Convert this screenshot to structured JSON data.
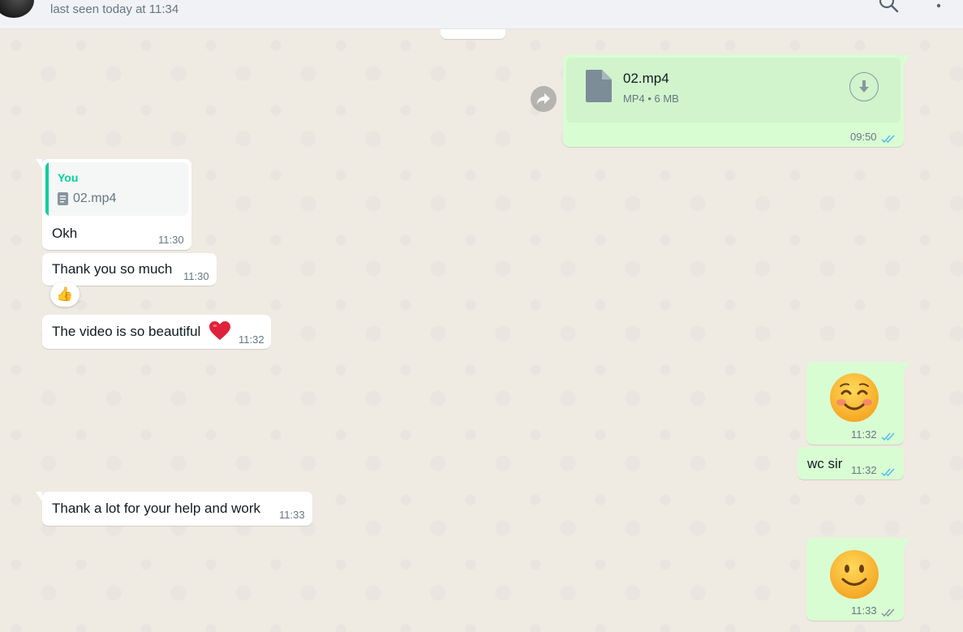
{
  "header": {
    "last_seen": "last seen today at 11:34",
    "search_icon": "search-icon",
    "menu_icon": "menu-dots-icon"
  },
  "colors": {
    "incoming_bubble": "#ffffff",
    "outgoing_bubble": "#d9fdd3",
    "chat_background": "#efeae2",
    "accent_green": "#06cf9c",
    "read_tick_blue": "#53bdeb",
    "delivered_tick_grey": "#8696a0"
  },
  "messages": [
    {
      "id": "m1",
      "direction": "out",
      "type": "file",
      "file_name": "02.mp4",
      "file_meta": "MP4 • 6 MB",
      "time": "09:50",
      "status": "read"
    },
    {
      "id": "m2",
      "direction": "in",
      "type": "reply",
      "quote_author": "You",
      "quote_file": "02.mp4",
      "text": "Okh",
      "time": "11:30"
    },
    {
      "id": "m3",
      "direction": "in",
      "type": "text",
      "text": "Thank you so much",
      "time": "11:30",
      "reaction": "👍"
    },
    {
      "id": "m4",
      "direction": "in",
      "type": "text",
      "text": "The video is so beautiful",
      "emoji": "heart",
      "time": "11:32"
    },
    {
      "id": "m5",
      "direction": "out",
      "type": "emoji",
      "emoji": "smiling-face-with-smiling-eyes",
      "time": "11:32",
      "status": "read"
    },
    {
      "id": "m6",
      "direction": "out",
      "type": "text",
      "text": "wc sir",
      "time": "11:32",
      "status": "read"
    },
    {
      "id": "m7",
      "direction": "in",
      "type": "text",
      "text": "Thank a lot for your help and work",
      "time": "11:33"
    },
    {
      "id": "m8",
      "direction": "out",
      "type": "emoji",
      "emoji": "slightly-smiling-face",
      "time": "11:33",
      "status": "delivered"
    }
  ]
}
